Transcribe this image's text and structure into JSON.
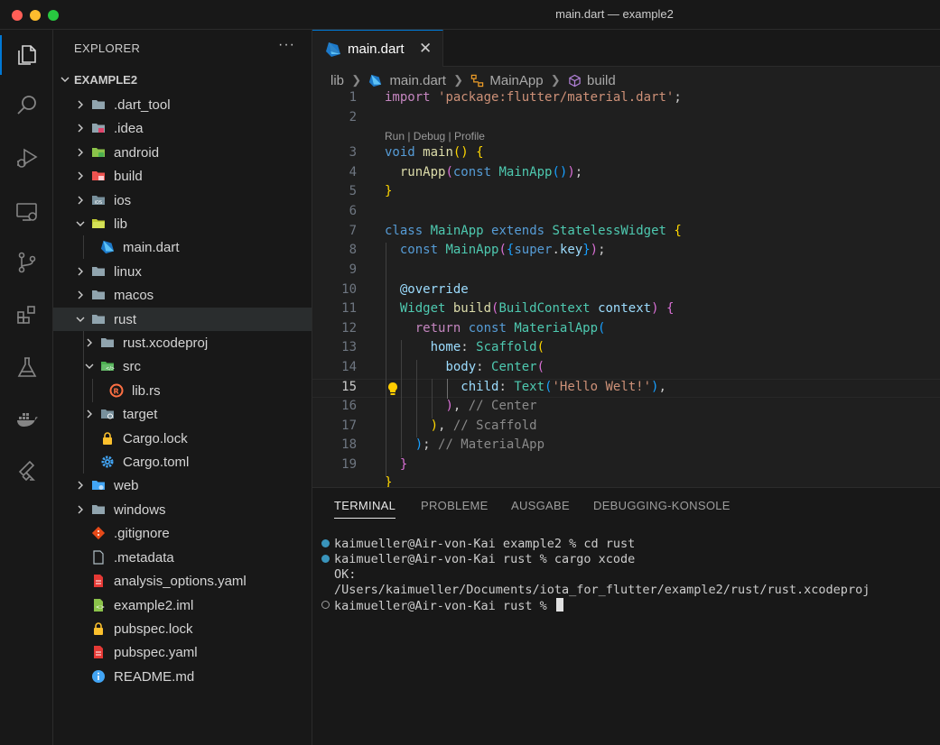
{
  "window": {
    "title": "main.dart — example2"
  },
  "colors": {
    "accent": "#0078d4",
    "background": "#1f1f1f",
    "sidebar": "#181818"
  },
  "activity_bar": [
    {
      "name": "explorer",
      "icon": "files-icon"
    },
    {
      "name": "search",
      "icon": "search-icon"
    },
    {
      "name": "run-and-debug",
      "icon": "run-debug-icon"
    },
    {
      "name": "remote-explorer",
      "icon": "remote-explorer-icon"
    },
    {
      "name": "source-control",
      "icon": "source-control-icon"
    },
    {
      "name": "extensions",
      "icon": "extensions-icon"
    },
    {
      "name": "testing",
      "icon": "flask-icon"
    },
    {
      "name": "docker",
      "icon": "docker-icon"
    },
    {
      "name": "flutter",
      "icon": "flutter-icon"
    }
  ],
  "explorer": {
    "header": "EXPLORER",
    "more": "···",
    "root": "EXAMPLE2",
    "items": [
      {
        "name": ".dart_tool",
        "type": "folder",
        "expanded": false,
        "icon": "folder-icon"
      },
      {
        "name": ".idea",
        "type": "folder",
        "expanded": false,
        "icon": "folder-idea-icon"
      },
      {
        "name": "android",
        "type": "folder",
        "expanded": false,
        "icon": "folder-android-icon"
      },
      {
        "name": "build",
        "type": "folder",
        "expanded": false,
        "icon": "folder-build-icon"
      },
      {
        "name": "ios",
        "type": "folder",
        "expanded": false,
        "icon": "folder-ios-icon"
      },
      {
        "name": "lib",
        "type": "folder",
        "expanded": true,
        "icon": "folder-lib-icon"
      },
      {
        "name": "main.dart",
        "type": "file",
        "icon": "dart-icon"
      },
      {
        "name": "linux",
        "type": "folder",
        "expanded": false,
        "icon": "folder-icon"
      },
      {
        "name": "macos",
        "type": "folder",
        "expanded": false,
        "icon": "folder-icon"
      },
      {
        "name": "rust",
        "type": "folder",
        "expanded": true,
        "icon": "folder-icon",
        "selected": true
      },
      {
        "name": "rust.xcodeproj",
        "type": "folder",
        "expanded": false,
        "icon": "folder-icon"
      },
      {
        "name": "src",
        "type": "folder",
        "expanded": true,
        "icon": "folder-src-icon"
      },
      {
        "name": "lib.rs",
        "type": "file",
        "icon": "rust-icon"
      },
      {
        "name": "target",
        "type": "folder",
        "expanded": false,
        "icon": "folder-target-icon"
      },
      {
        "name": "Cargo.lock",
        "type": "file",
        "icon": "lock-icon"
      },
      {
        "name": "Cargo.toml",
        "type": "file",
        "icon": "gear-icon"
      },
      {
        "name": "web",
        "type": "folder",
        "expanded": false,
        "icon": "folder-web-icon"
      },
      {
        "name": "windows",
        "type": "folder",
        "expanded": false,
        "icon": "folder-icon"
      },
      {
        "name": ".gitignore",
        "type": "file",
        "icon": "git-icon"
      },
      {
        "name": ".metadata",
        "type": "file",
        "icon": "file-icon"
      },
      {
        "name": "analysis_options.yaml",
        "type": "file",
        "icon": "yaml-icon"
      },
      {
        "name": "example2.iml",
        "type": "file",
        "icon": "iml-icon"
      },
      {
        "name": "pubspec.lock",
        "type": "file",
        "icon": "lock-icon"
      },
      {
        "name": "pubspec.yaml",
        "type": "file",
        "icon": "yaml-icon"
      },
      {
        "name": "README.md",
        "type": "file",
        "icon": "info-icon"
      }
    ]
  },
  "editor": {
    "tab": {
      "label": "main.dart",
      "close": "✕"
    },
    "breadcrumb": [
      "lib",
      "main.dart",
      "MainApp",
      "build"
    ],
    "codelens": "Run | Debug | Profile",
    "current_line": "15",
    "line_numbers": [
      "1",
      "2",
      "3",
      "4",
      "5",
      "6",
      "7",
      "8",
      "9",
      "10",
      "11",
      "12",
      "13",
      "14",
      "15",
      "16",
      "17",
      "18",
      "19"
    ]
  },
  "panel": {
    "tabs": [
      "TERMINAL",
      "PROBLEME",
      "AUSGABE",
      "DEBUGGING-KONSOLE"
    ],
    "terminal": [
      "kaimueller@Air-von-Kai example2 % cd rust",
      "kaimueller@Air-von-Kai rust % cargo xcode",
      "OK:",
      "/Users/kaimueller/Documents/iota_for_flutter/example2/rust/rust.xcodeproj",
      "kaimueller@Air-von-Kai rust % "
    ]
  }
}
